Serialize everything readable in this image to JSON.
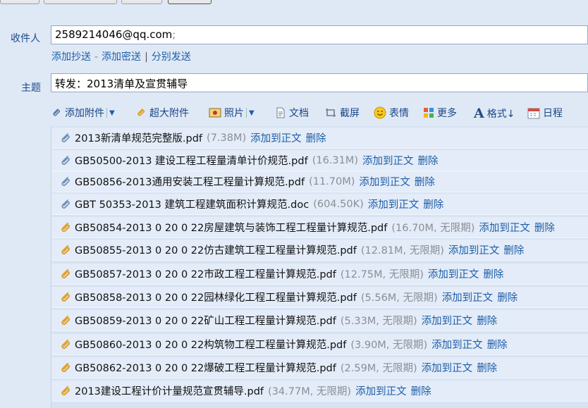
{
  "recipients": {
    "label": "收件人",
    "value": "2589214046@qq.com",
    "separator": ";"
  },
  "recipient_links": {
    "cc": "添加抄送",
    "dash": "-",
    "bcc": "添加密送",
    "pipe": "|",
    "separate": "分别发送"
  },
  "subject": {
    "label": "主题",
    "value": "转发：2013清单及宣贯辅导"
  },
  "toolbar": {
    "add_attachment": "添加附件",
    "large_attachment": "超大附件",
    "photo": "照片",
    "document": "文档",
    "screenshot": "截屏",
    "emoji": "表情",
    "more": "更多",
    "format": "格式↓",
    "schedule": "日程"
  },
  "attachments": [
    {
      "name": "2013新清单规范完整版.pdf",
      "size": "(7.38M)",
      "action": "添加到正文",
      "delete": "删除",
      "type": "normal"
    },
    {
      "name": "GB50500-2013 建设工程工程量清单计价规范.pdf",
      "size": "(16.31M)",
      "action": "添加到正文",
      "delete": "删除",
      "type": "normal"
    },
    {
      "name": "GB50856-2013通用安装工程工程量计算规范.pdf",
      "size": "(11.70M)",
      "action": "添加到正文",
      "delete": "删除",
      "type": "normal"
    },
    {
      "name": "GBT 50353-2013 建筑工程建筑面积计算规范.doc",
      "size": "(604.50K)",
      "action": "添加到正文",
      "delete": "删除",
      "type": "normal"
    },
    {
      "name": "GB50854-2013 0 20 0 22房屋建筑与装饰工程工程量计算规范.pdf",
      "size": "(16.70M, 无限期)",
      "action": "添加到正文",
      "delete": "删除",
      "type": "large"
    },
    {
      "name": "GB50855-2013 0 20 0 22仿古建筑工程工程量计算规范.pdf",
      "size": "(12.81M, 无限期)",
      "action": "添加到正文",
      "delete": "删除",
      "type": "large"
    },
    {
      "name": "GB50857-2013 0 20 0 22市政工程工程量计算规范.pdf",
      "size": "(12.75M, 无限期)",
      "action": "添加到正文",
      "delete": "删除",
      "type": "large"
    },
    {
      "name": "GB50858-2013 0 20 0 22园林绿化工程工程量计算规范.pdf",
      "size": "(5.56M, 无限期)",
      "action": "添加到正文",
      "delete": "删除",
      "type": "large"
    },
    {
      "name": "GB50859-2013 0 20 0 22矿山工程工程量计算规范.pdf",
      "size": "(5.33M, 无限期)",
      "action": "添加到正文",
      "delete": "删除",
      "type": "large"
    },
    {
      "name": "GB50860-2013 0 20 0 22构筑物工程工程量计算规范.pdf",
      "size": "(3.90M, 无限期)",
      "action": "添加到正文",
      "delete": "删除",
      "type": "large"
    },
    {
      "name": "GB50862-2013 0 20 0 22爆破工程工程量计算规范.pdf",
      "size": "(2.59M, 无限期)",
      "action": "添加到正文",
      "delete": "删除",
      "type": "large"
    },
    {
      "name": "2013建设工程计价计量规范宣贯辅导.pdf",
      "size": "(34.77M, 无限期)",
      "action": "添加到正文",
      "delete": "删除",
      "type": "large"
    }
  ],
  "colors": {
    "background": "#dfe9f6",
    "link": "#1f5ea8",
    "label": "#1c4a8a",
    "normal_clip": "#6f8fb8",
    "large_clip": "#e0a230"
  }
}
